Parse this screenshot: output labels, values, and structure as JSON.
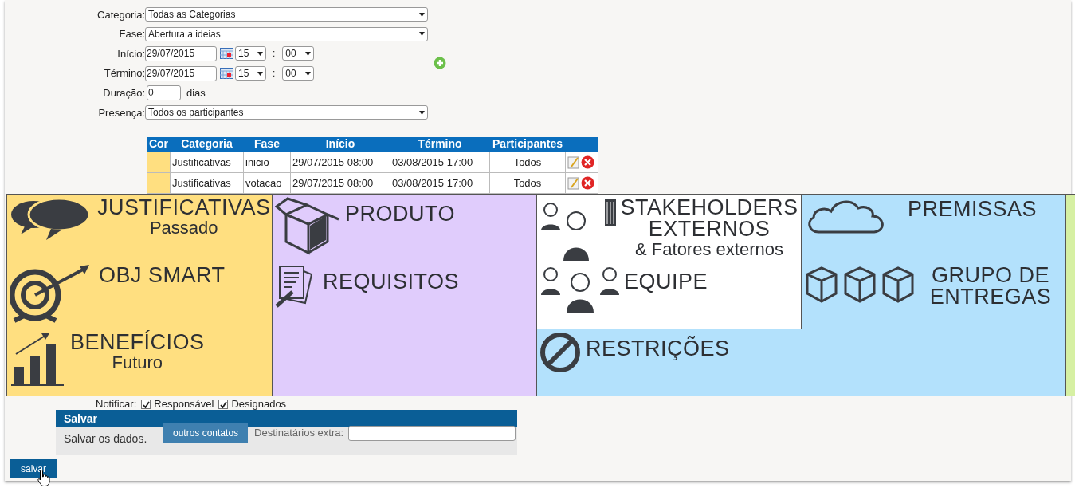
{
  "form": {
    "fields": [
      {
        "kind": "select",
        "label": "Categoria:",
        "value": "Todas as Categorias"
      },
      {
        "kind": "select",
        "label": "Fase:",
        "value": "Abertura a ideias"
      },
      {
        "kind": "datetime",
        "label": "Início:",
        "date": "29/07/2015",
        "hour": "15",
        "separator": ":",
        "minute": "00"
      },
      {
        "kind": "datetime",
        "label": "Término:",
        "date": "29/07/2015",
        "hour": "15",
        "separator": ":",
        "minute": "00"
      },
      {
        "kind": "number",
        "label": "Duração:",
        "value": "0",
        "unit": "dias"
      },
      {
        "kind": "select",
        "label": "Presença:",
        "value": "Todos os participantes"
      }
    ]
  },
  "schedule": {
    "columns": [
      "Cor",
      "Categoria",
      "Fase",
      "Início",
      "Término",
      "Participantes"
    ],
    "rows": [
      {
        "color": "#ffdf80",
        "categoria": "Justificativas",
        "fase": "inicio",
        "inicio": "29/07/2015 08:00",
        "termino": "03/08/2015 17:00",
        "participantes": "Todos"
      },
      {
        "color": "#ffdf80",
        "categoria": "Justificativas",
        "fase": "votacao",
        "inicio": "29/07/2015 08:00",
        "termino": "03/08/2015 17:00",
        "participantes": "Todos"
      }
    ]
  },
  "canvas": {
    "cells": [
      {
        "kind": "speech",
        "title": "JUSTIFICATIVAS",
        "subtitle": "Passado",
        "color": "#ffdf80"
      },
      {
        "kind": "box",
        "title": "PRODUTO",
        "color": "#e0ccfc"
      },
      {
        "kind": "stakeholders",
        "title": "STAKEHOLDERS EXTERNOS",
        "subtitle": "& Fatores externos",
        "color": "#ffffff"
      },
      {
        "kind": "cloud",
        "title": "PREMISSAS",
        "color": "#b3e1fc"
      },
      {
        "kind": "clipped",
        "color": "#d6f0a3"
      },
      {
        "kind": "target",
        "title": "OBJ SMART",
        "color": "#ffdf80"
      },
      {
        "kind": "document",
        "title": "REQUISITOS",
        "color": "#e0ccfc"
      },
      {
        "kind": "team",
        "title": "EQUIPE",
        "color": "#ffffff"
      },
      {
        "kind": "boxes",
        "title": "GRUPO DE ENTREGAS",
        "color": "#b3e1fc"
      },
      {
        "kind": "clipped",
        "color": "#d6f0a3"
      },
      {
        "kind": "chart",
        "title": "BENEFÍCIOS",
        "subtitle": "Futuro",
        "color": "#ffdf80"
      },
      {
        "kind": "forbidden",
        "title": "RESTRIÇÕES",
        "color": "#b3e1fc"
      },
      {
        "kind": "clipped",
        "color": "#d6f0a3"
      }
    ]
  },
  "notify": {
    "label": "Notificar:",
    "options": [
      {
        "label": "Responsável",
        "checked": true
      },
      {
        "label": "Designados",
        "checked": true
      }
    ],
    "contacts_button": "outros contatos",
    "extra_label": "Destinatários extra:"
  },
  "tooltip": {
    "title": "Salvar",
    "text": "Salvar os dados."
  },
  "save_button": "salvar"
}
